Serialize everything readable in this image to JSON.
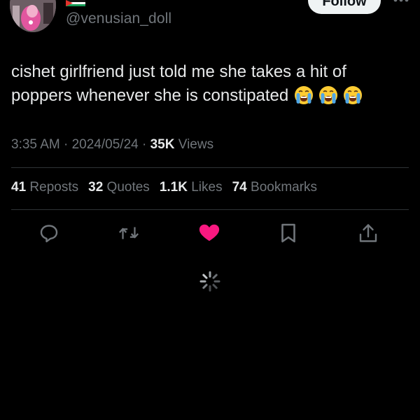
{
  "author": {
    "handle": "@venusian_doll"
  },
  "header": {
    "follow_label": "Follow"
  },
  "tweet": {
    "text_line_1": "cishet girlfriend just told me she takes a hit of",
    "text_line_2": "poppers whenever she is constipated",
    "emojis": [
      "loudly-crying-face",
      "loudly-crying-face",
      "loudly-crying-face"
    ]
  },
  "meta": {
    "time": "3:35 AM",
    "separator": "·",
    "date": "2024/05/24",
    "views_count": "35K",
    "views_label": "Views"
  },
  "stats": {
    "reposts_count": "41",
    "reposts_label": "Reposts",
    "quotes_count": "32",
    "quotes_label": "Quotes",
    "likes_count": "1.1K",
    "likes_label": "Likes",
    "bookmarks_count": "74",
    "bookmarks_label": "Bookmarks"
  },
  "actions": [
    "reply-icon",
    "retweet-icon",
    "heart-icon",
    "bookmark-icon",
    "share-icon"
  ],
  "colors": {
    "background": "#000000",
    "primary_text": "#e7e9ea",
    "secondary_text": "#71767b",
    "divider": "#2f3336",
    "like_pink": "#f91880",
    "follow_bg": "#eff3f4"
  }
}
